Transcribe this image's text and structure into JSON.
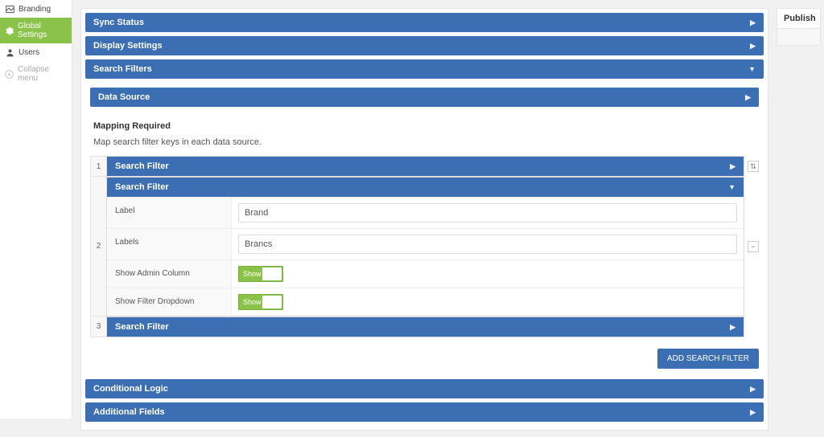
{
  "sidebar": {
    "items": [
      {
        "label": "Branding"
      },
      {
        "label": "Global Settings"
      },
      {
        "label": "Users"
      },
      {
        "label": "Collapse menu"
      }
    ]
  },
  "publish": {
    "title": "Publish"
  },
  "panels": {
    "sync": "Sync Status",
    "display": "Display Settings",
    "searchFilters": "Search Filters",
    "dataSource": "Data Source",
    "mappingTitle": "Mapping Required",
    "mappingDesc": "Map search filter keys in each data source.",
    "conditional": "Conditional Logic",
    "additional": "Additional Fields"
  },
  "filters": [
    {
      "num": "1",
      "title": "Search Filter"
    },
    {
      "num": "2",
      "title": "Search Filter",
      "fields": {
        "labelKey": "Label",
        "labelVal": "Brand",
        "labelsKey": "Labels",
        "labelsVal": "Brancs",
        "adminKey": "Show Admin Column",
        "adminVal": "Show",
        "dropdownKey": "Show Filter Dropdown",
        "dropdownVal": "Show"
      }
    },
    {
      "num": "3",
      "title": "Search Filter"
    }
  ],
  "buttons": {
    "add": "ADD SEARCH FILTER"
  }
}
